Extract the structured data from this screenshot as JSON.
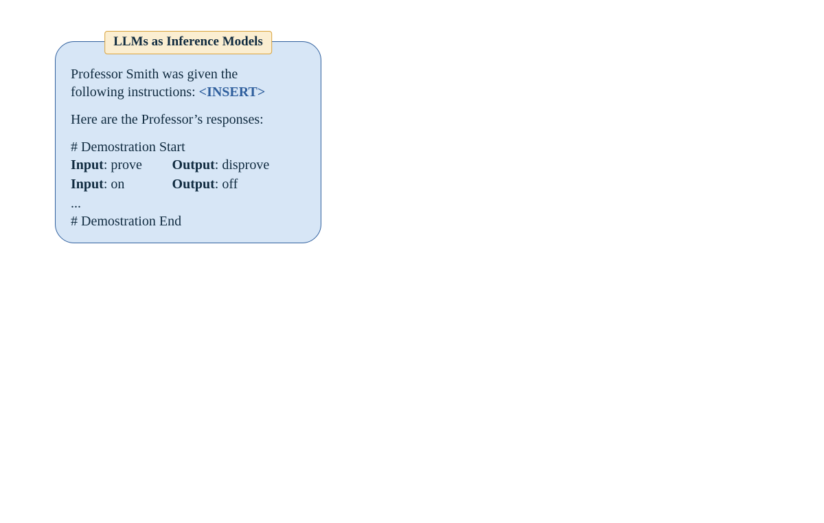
{
  "card": {
    "title": "LLMs as Inference Models",
    "line1a": "Professor Smith was given the",
    "line1b": "following instructions: ",
    "insert_token": "<INSERT>",
    "line2": "Here are the Professor’s responses:",
    "demo_start": "# Demostration Start",
    "demo_end": "# Demostration End",
    "ellipsis": "...",
    "input_label": "Input",
    "output_label": "Output",
    "colon": ": ",
    "rows": [
      {
        "in": "prove",
        "out": "disprove"
      },
      {
        "in": "on",
        "out": "off"
      }
    ]
  }
}
